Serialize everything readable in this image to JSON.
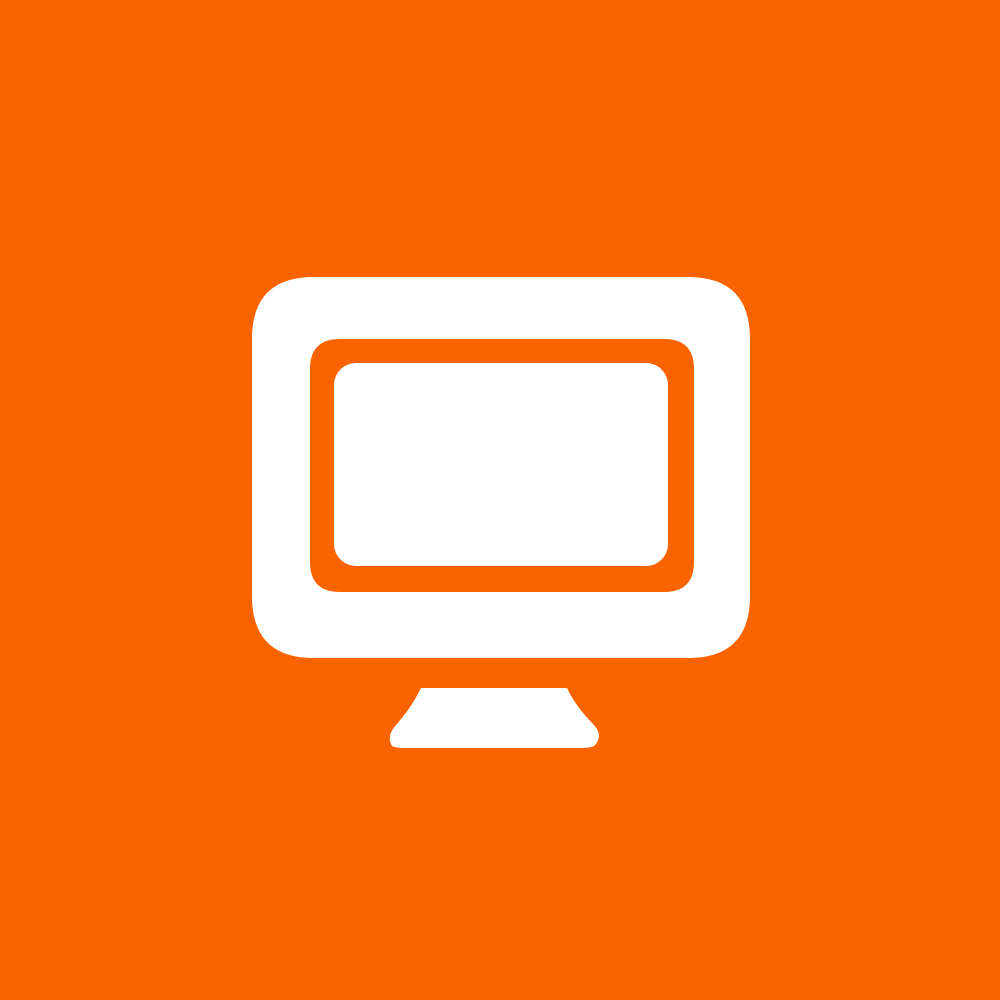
{
  "icon": {
    "name": "monitor-icon",
    "background_color": "#f96401",
    "foreground_color": "#ffffff"
  }
}
